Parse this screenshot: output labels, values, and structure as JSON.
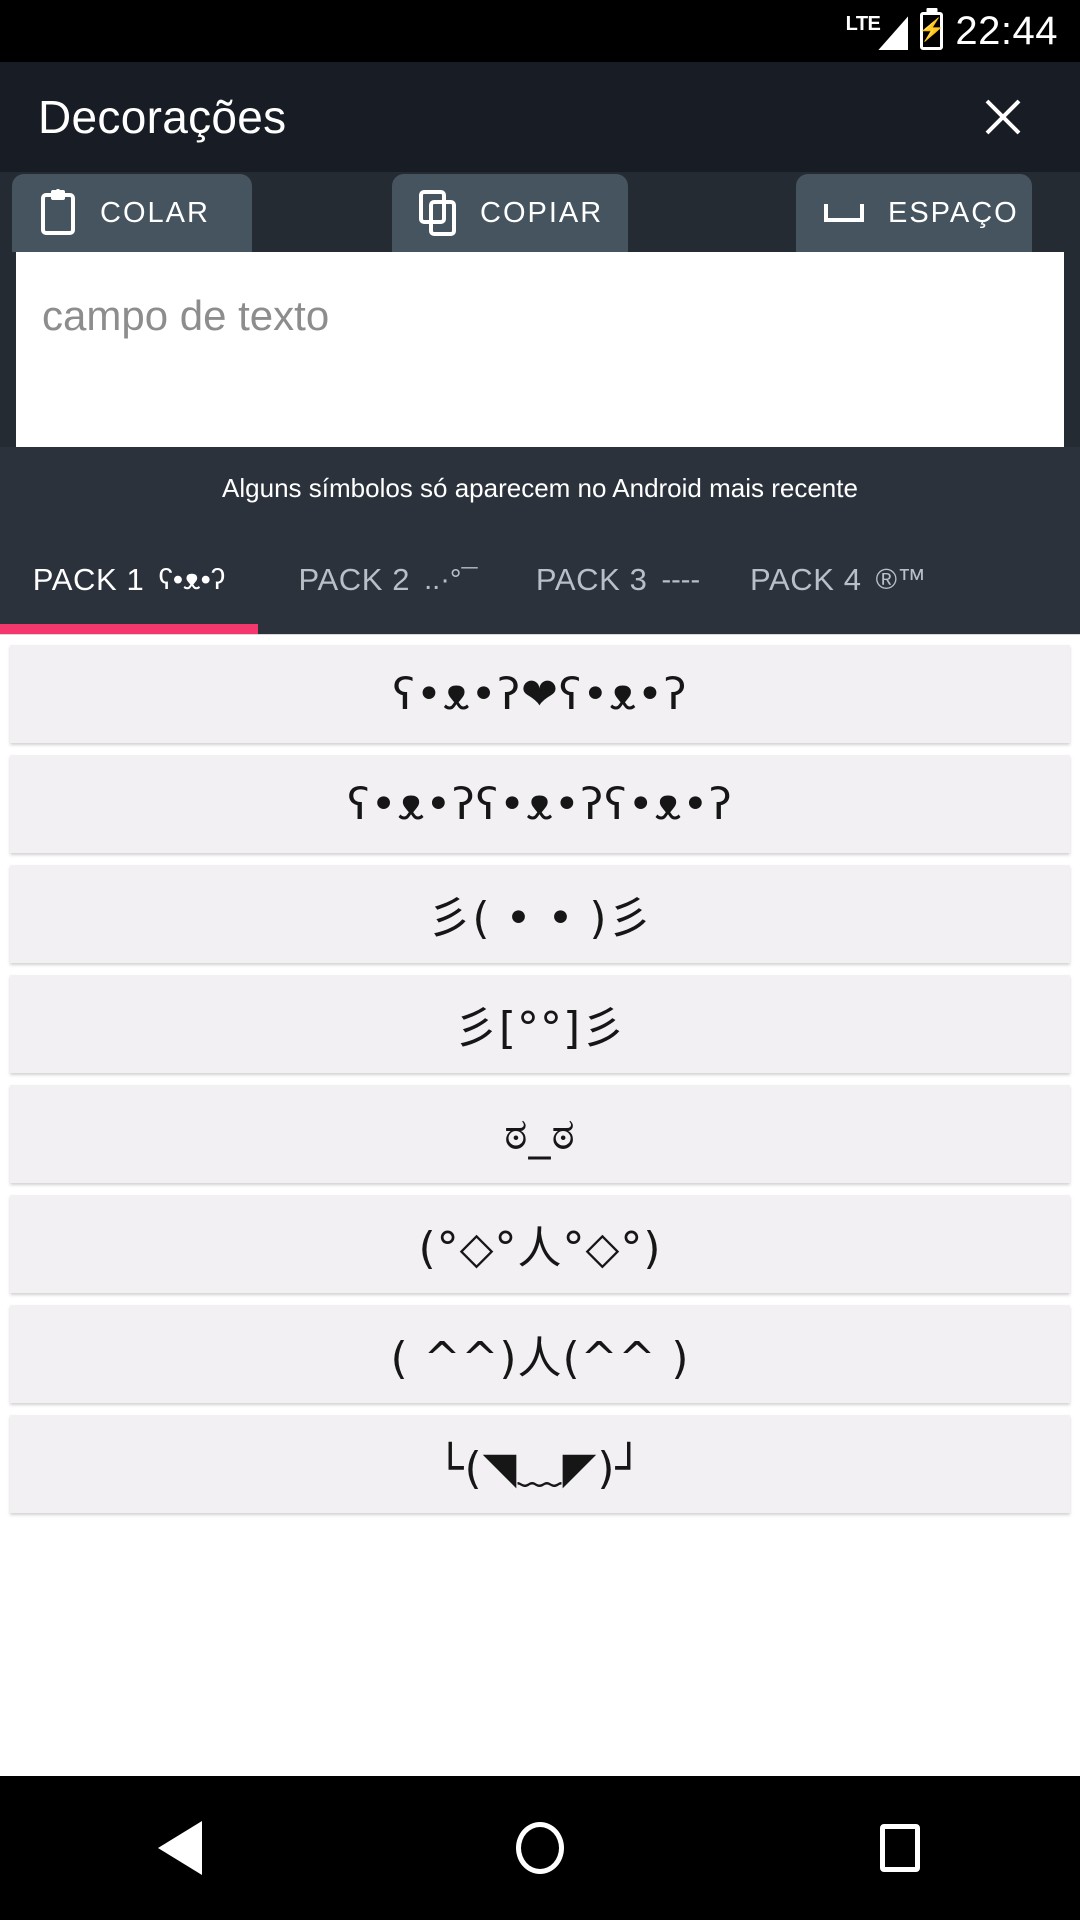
{
  "status_bar": {
    "network_label": "LTE",
    "signal_icon": "signal-bars-icon",
    "battery_icon": "battery-charging-icon",
    "battery_bolt": "⚡",
    "time": "22:44"
  },
  "title_bar": {
    "title": "Decorações",
    "close_label": "✕",
    "background_color": "#181c24"
  },
  "actions": [
    {
      "label": "COLAR",
      "icon": "clipboard-paste-icon"
    },
    {
      "label": "COPIAR",
      "icon": "copy-icon"
    },
    {
      "label": "ESPAÇO",
      "icon": "space-bar-icon"
    }
  ],
  "text_field": {
    "placeholder": "campo de texto",
    "value": ""
  },
  "hint": {
    "text": "Alguns símbolos só aparecem no Android mais recente"
  },
  "tabs": {
    "active_index": 0,
    "indicator_color": "#f4376d",
    "items": [
      {
        "label": "PACK 1",
        "glyph": "ʕ•ᴥ•ʔ"
      },
      {
        "label": "PACK 2",
        "glyph": "..·°¯"
      },
      {
        "label": "PACK 3",
        "glyph": "----"
      },
      {
        "label": "PACK 4",
        "glyph": "®™"
      }
    ]
  },
  "list": {
    "items": [
      {
        "text": "ʕ•ᴥ•ʔ❤ʕ•ᴥ•ʔ"
      },
      {
        "text": "ʕ•ᴥ•ʔʕ•ᴥ•ʔʕ•ᴥ•ʔ"
      },
      {
        "text": "彡( •  • )彡"
      },
      {
        "text": "彡[°°]彡"
      },
      {
        "text": "ಠ_ಠ"
      },
      {
        "text": "(°◇°人°◇°)"
      },
      {
        "text": "( ^^)人(^^ )"
      },
      {
        "text": "└(◥﹏◤)┘"
      }
    ]
  },
  "nav_bar": {
    "back_icon": "back-triangle-icon",
    "home_icon": "home-circle-icon",
    "recents_icon": "recents-square-icon"
  }
}
